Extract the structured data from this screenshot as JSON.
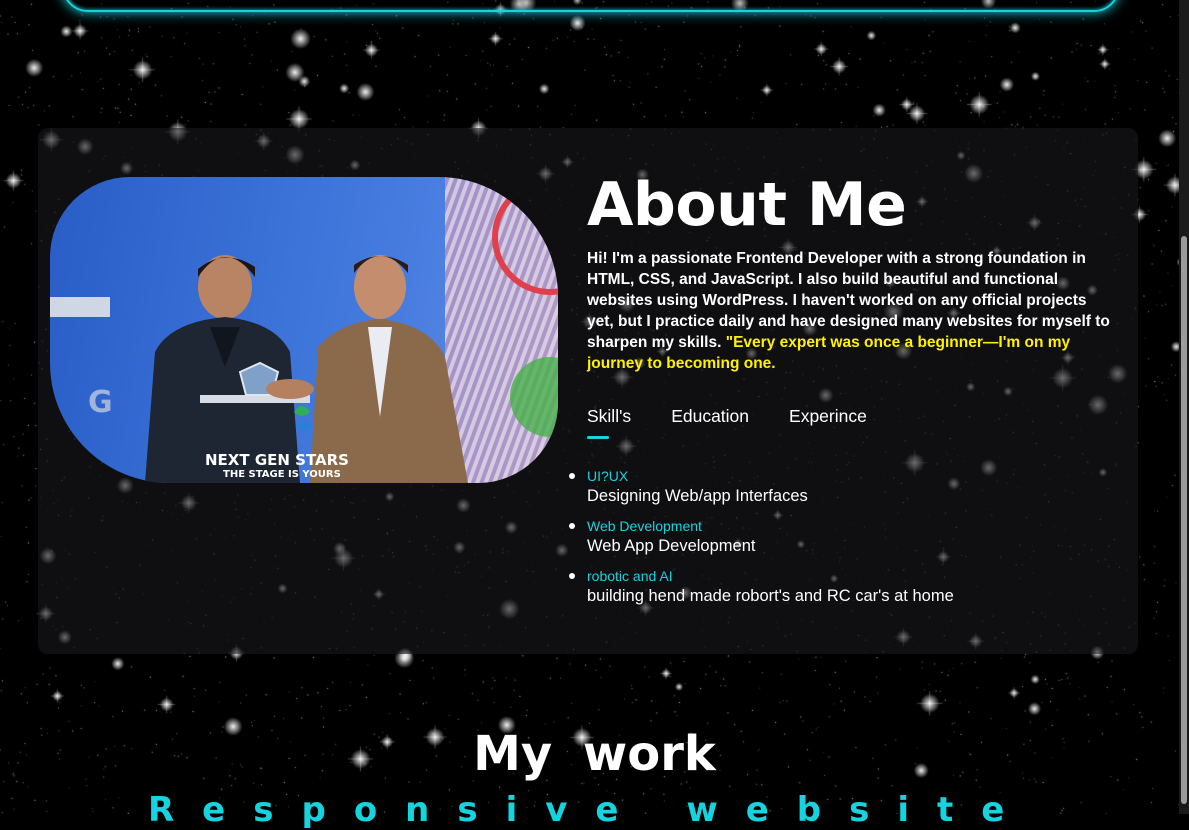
{
  "about": {
    "title": "About Me",
    "paragraph": "Hi! I'm a passionate Frontend Developer with a strong foundation in HTML, CSS, and JavaScript. I also build beautiful and functional websites using WordPress. I haven't worked on any official projects yet, but I practice daily and have designed many websites for myself to sharpen my skills. ",
    "quote": "\"Every expert was once a beginner—I'm on my journey to becoming one.",
    "photo": {
      "banner_title": "NEXT GEN STARS",
      "banner_subtitle": "THE STAGE IS YOURS"
    },
    "tabs": [
      {
        "label": "Skill's",
        "active": true
      },
      {
        "label": "Education",
        "active": false
      },
      {
        "label": "Experince",
        "active": false
      }
    ],
    "skills": [
      {
        "title": "UI?UX",
        "description": "Designing Web/app Interfaces"
      },
      {
        "title": "Web Development",
        "description": "Web App Development"
      },
      {
        "title": "robotic and AI",
        "description": "building hend made robort's and RC car's at home"
      }
    ]
  },
  "work": {
    "title": "My work",
    "subtitle": "Responsive website"
  },
  "colors": {
    "accent": "#16d3e0",
    "quote": "#fff200",
    "background": "#000000"
  }
}
